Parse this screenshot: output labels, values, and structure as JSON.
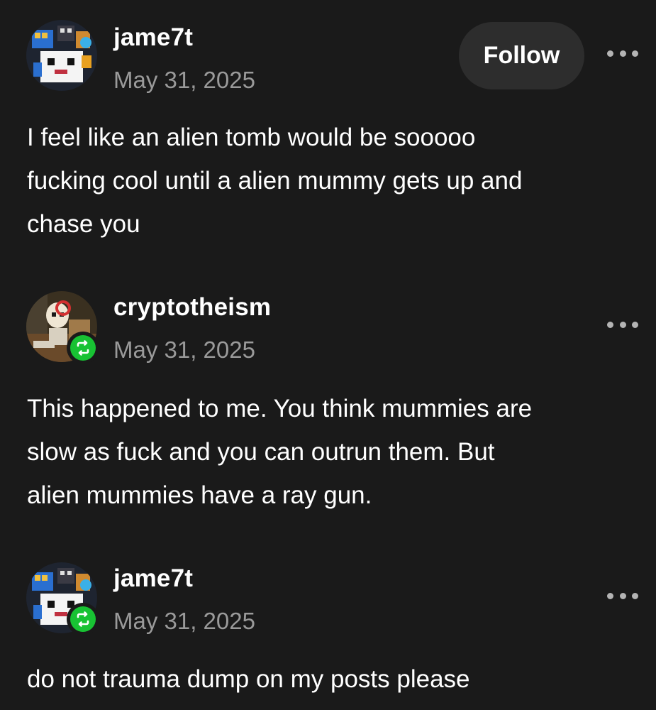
{
  "posts": [
    {
      "username": "jame7t",
      "date": "May 31, 2025",
      "follow_label": "Follow",
      "body_lines": [
        "I feel like an alien tomb would be sooooo",
        "fucking cool until a alien mummy gets up and",
        "chase you"
      ]
    },
    {
      "username": "cryptotheism",
      "date": "May 31, 2025",
      "body_lines": [
        "This happened to me. You think mummies are",
        "slow as fuck and you can outrun them. But",
        "alien mummies have a ray gun."
      ]
    },
    {
      "username": "jame7t",
      "date": "May 31, 2025",
      "body_lines": [
        "do not trauma dump on my posts please"
      ]
    }
  ],
  "icons": {
    "more": "more-options-icon",
    "reblog": "reblog-icon"
  },
  "colors": {
    "background": "#1a1a1a",
    "text": "#ffffff",
    "muted": "#9a9a9a",
    "reblog_badge": "#18c233",
    "follow_button": "#2d2d2d"
  }
}
